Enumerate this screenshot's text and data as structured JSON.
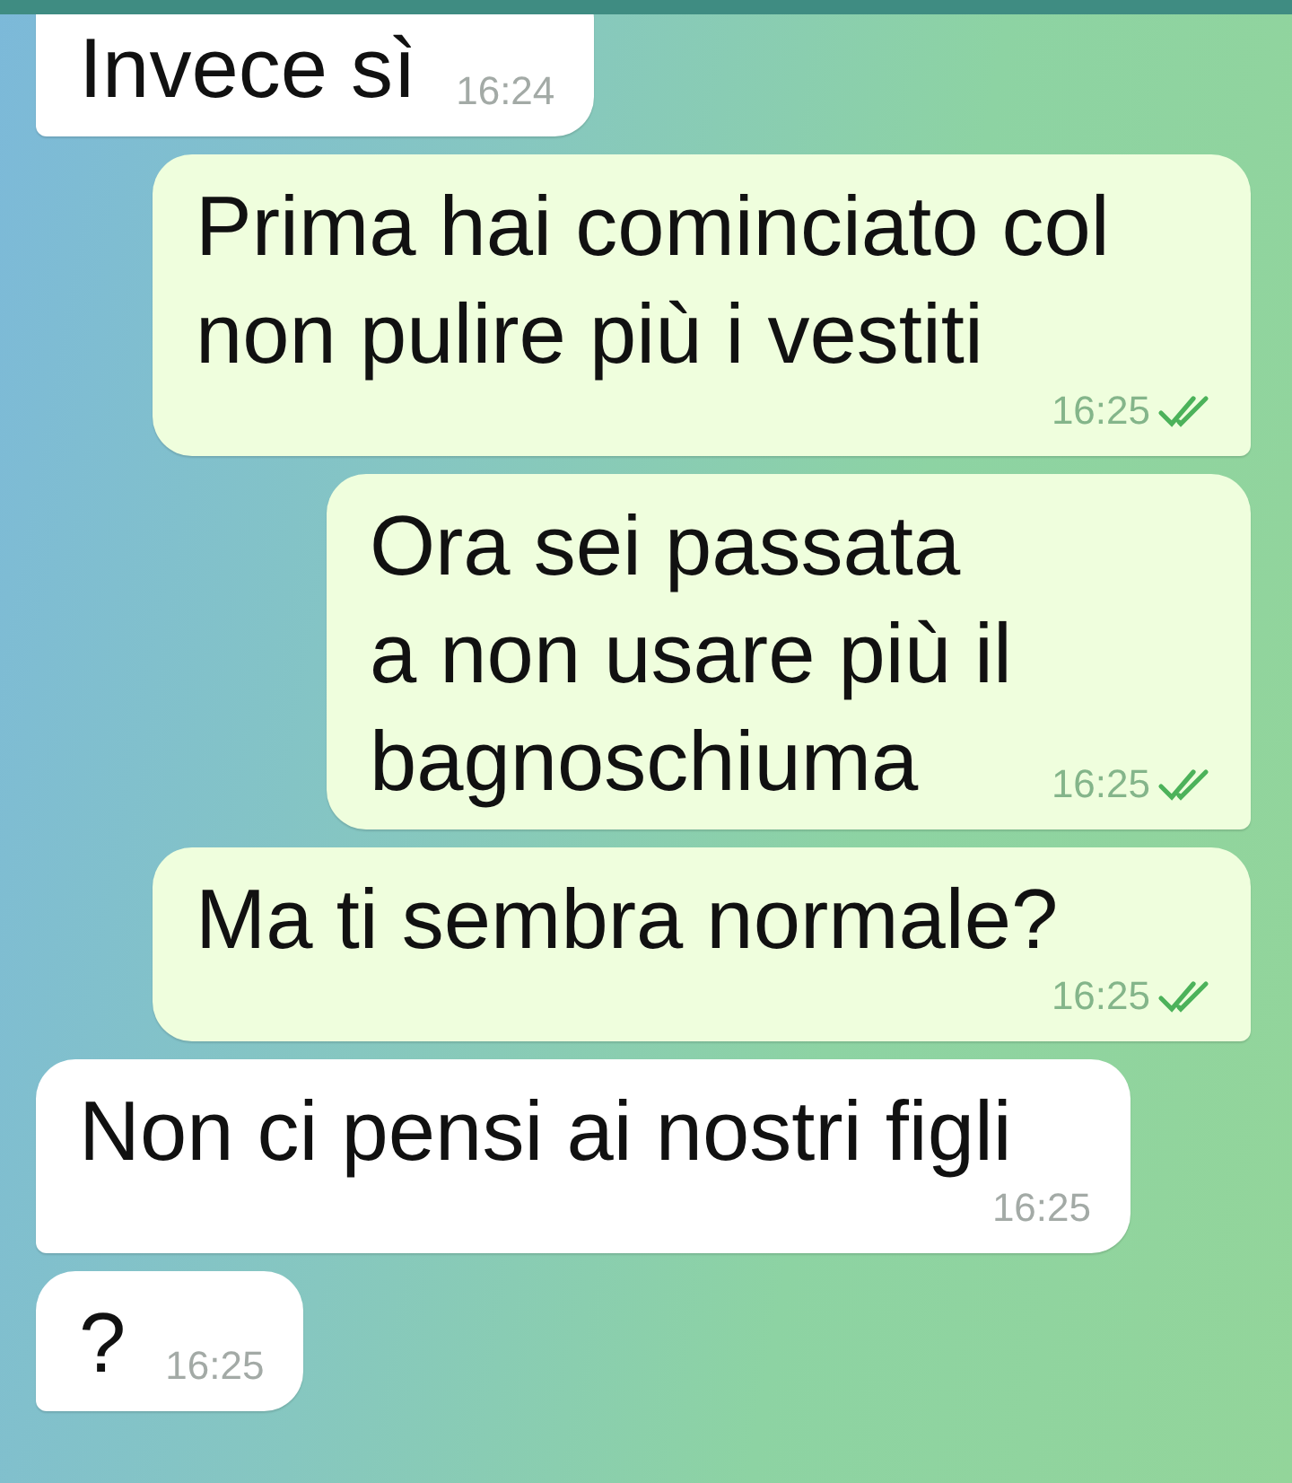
{
  "messages": [
    {
      "kind": "in",
      "text": "Invece sì",
      "time": "16:24"
    },
    {
      "kind": "out",
      "text": "Prima hai cominciato col\nnon pulire più i vestiti",
      "time": "16:25",
      "read": true
    },
    {
      "kind": "out",
      "text": "Ora sei passata\na non usare più il\nbagnoschiuma",
      "time": "16:25",
      "read": true
    },
    {
      "kind": "out",
      "text": "Ma ti sembra normale?",
      "time": "16:25",
      "read": true
    },
    {
      "kind": "in",
      "text": "Non ci pensi ai nostri figli",
      "time": "16:25"
    },
    {
      "kind": "in",
      "text": "?",
      "time": "16:25"
    }
  ]
}
